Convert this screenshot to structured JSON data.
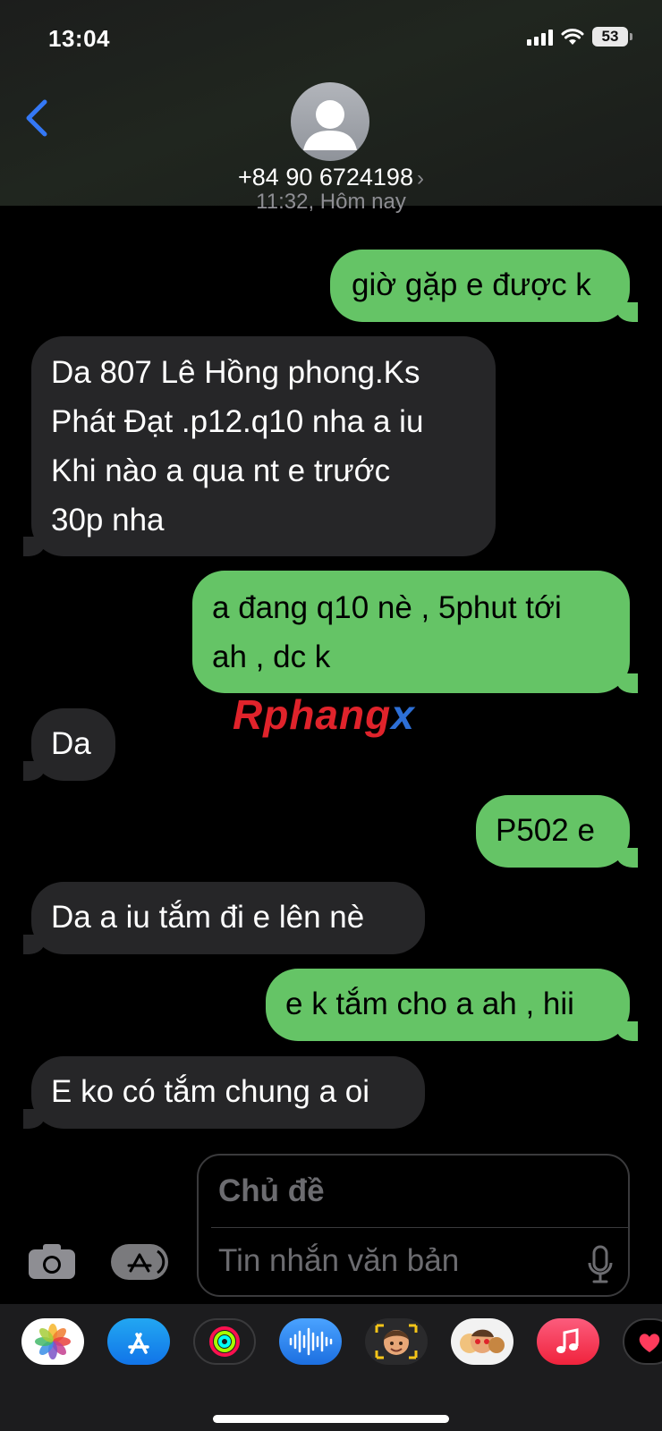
{
  "status_bar": {
    "time": "13:04",
    "battery": "53"
  },
  "header": {
    "contact": "+84 90 6724198",
    "timestamp": "11:32, Hôm nay"
  },
  "messages": [
    {
      "from": "me",
      "text": "giờ gặp e được k"
    },
    {
      "from": "them",
      "text": "Da 807 Lê Hồng phong.Ks\nPhát Đạt .p12.q10 nha a iu\nKhi nào a qua nt e trước\n30p nha"
    },
    {
      "from": "me",
      "text": "a đang q10 nè , 5phut tới\nah , dc k"
    },
    {
      "from": "them",
      "text": "Da"
    },
    {
      "from": "me",
      "text": "P502 e"
    },
    {
      "from": "them",
      "text": "Da a iu tắm đi e lên nè"
    },
    {
      "from": "me",
      "text": "e k tắm cho a ah , hii"
    },
    {
      "from": "them",
      "text": "E ko có tắm chung a oi"
    }
  ],
  "watermark": {
    "part1": "Rphang",
    "part2": "x"
  },
  "compose": {
    "subject_placeholder": "Chủ đề",
    "body_placeholder": "Tin nhắn văn bản"
  },
  "app_drawer": [
    "photos-app",
    "app-store-app",
    "activity-app",
    "audio-message-app",
    "memoji-app",
    "memoji-stickers-app",
    "music-app",
    "digital-touch-app"
  ],
  "colors": {
    "outgoing_bubble": "#65c466",
    "incoming_bubble": "#262628",
    "accent": "#3478f6"
  }
}
